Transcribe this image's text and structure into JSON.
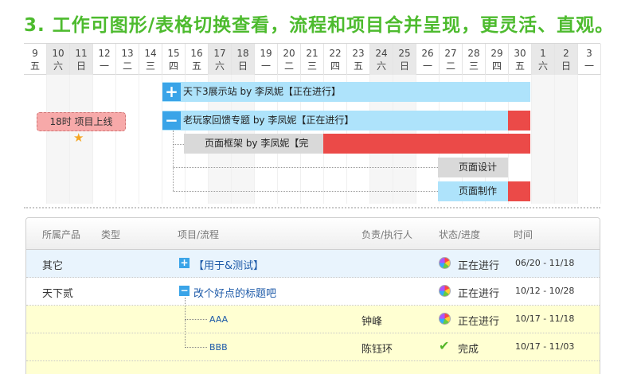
{
  "headline": "3. 工作可图形/表格切换查看，流程和项目合并呈现，更灵活、直观。",
  "calendar": [
    {
      "d": "9",
      "w": "五"
    },
    {
      "d": "10",
      "w": "六"
    },
    {
      "d": "11",
      "w": "日"
    },
    {
      "d": "12",
      "w": "一"
    },
    {
      "d": "13",
      "w": "二"
    },
    {
      "d": "14",
      "w": "三"
    },
    {
      "d": "15",
      "w": "四"
    },
    {
      "d": "16",
      "w": "五"
    },
    {
      "d": "17",
      "w": "六"
    },
    {
      "d": "18",
      "w": "日"
    },
    {
      "d": "19",
      "w": "一"
    },
    {
      "d": "20",
      "w": "二"
    },
    {
      "d": "21",
      "w": "三"
    },
    {
      "d": "22",
      "w": "四"
    },
    {
      "d": "23",
      "w": "五"
    },
    {
      "d": "24",
      "w": "六"
    },
    {
      "d": "25",
      "w": "日"
    },
    {
      "d": "26",
      "w": "一"
    },
    {
      "d": "27",
      "w": "二"
    },
    {
      "d": "28",
      "w": "三"
    },
    {
      "d": "29",
      "w": "四"
    },
    {
      "d": "30",
      "w": "五"
    },
    {
      "d": "1",
      "w": "六"
    },
    {
      "d": "2",
      "w": "日"
    },
    {
      "d": "3",
      "w": "一"
    }
  ],
  "gantt": {
    "milestone": "18时 项目上线",
    "tasks": [
      {
        "label": "天下3展示站 by 李凤妮【正在进行】",
        "toggle": "+"
      },
      {
        "label": "老玩家回馈专题 by 李凤妮【正在进行】",
        "toggle": "−"
      },
      {
        "label": "页面框架 by 李凤妮【完"
      },
      {
        "label": "页面设计"
      },
      {
        "label": "页面制作"
      }
    ]
  },
  "table": {
    "headers": {
      "product": "所属产品",
      "type": "类型",
      "project": "项目/流程",
      "owner": "负责/执行人",
      "status": "状态/进度",
      "time": "时间"
    },
    "rows": [
      {
        "product": "其它",
        "toggle": "+",
        "project": "【用于&测试】",
        "owner": "",
        "status": "正在进行",
        "time": "06/20 - 11/18"
      },
      {
        "product": "天下贰",
        "toggle": "−",
        "project": "改个好点的标题吧",
        "owner": "",
        "status": "正在进行",
        "time": "10/12 - 10/28"
      },
      {
        "product": "",
        "project": "AAA",
        "owner": "钟峰",
        "status": "正在进行",
        "time": "10/17 - 11/18"
      },
      {
        "product": "",
        "project": "BBB",
        "owner": "陈钰环",
        "status": "完成",
        "time": "10/17 - 11/03"
      }
    ]
  }
}
